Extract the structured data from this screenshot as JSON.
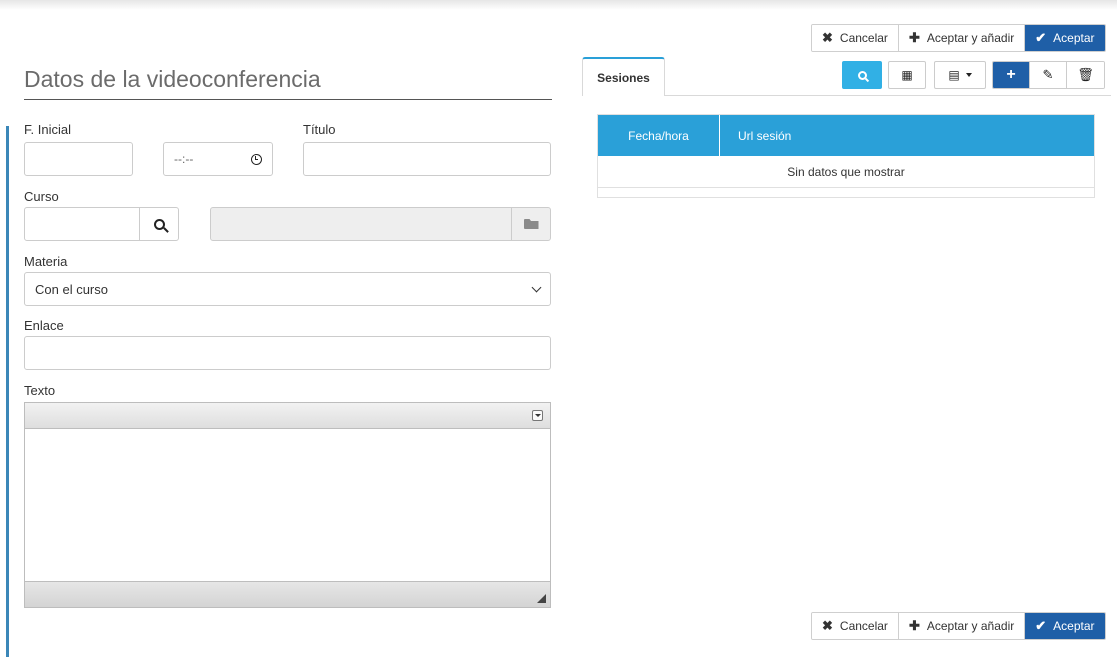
{
  "actions": {
    "cancel_label": "Cancelar",
    "accept_add_label": "Aceptar y añadir",
    "accept_label": "Aceptar"
  },
  "form": {
    "title": "Datos de la videoconferencia",
    "fecha_inicial_label": "F. Inicial",
    "fecha_inicial_value": "",
    "time_value": "--:--",
    "titulo_label": "Título",
    "titulo_value": "",
    "curso_label": "Curso",
    "curso_value": "",
    "curso_name_value": "",
    "materia_label": "Materia",
    "materia_value": "Con el curso",
    "enlace_label": "Enlace",
    "enlace_value": "",
    "texto_label": "Texto"
  },
  "sessions": {
    "tab_label": "Sesiones",
    "columns": [
      "Fecha/hora",
      "Url sesión"
    ],
    "empty_text": "Sin datos que mostrar"
  },
  "colors": {
    "primary": "#1f5fa7",
    "accent": "#2aa0d8",
    "search_button": "#31b0e5"
  }
}
